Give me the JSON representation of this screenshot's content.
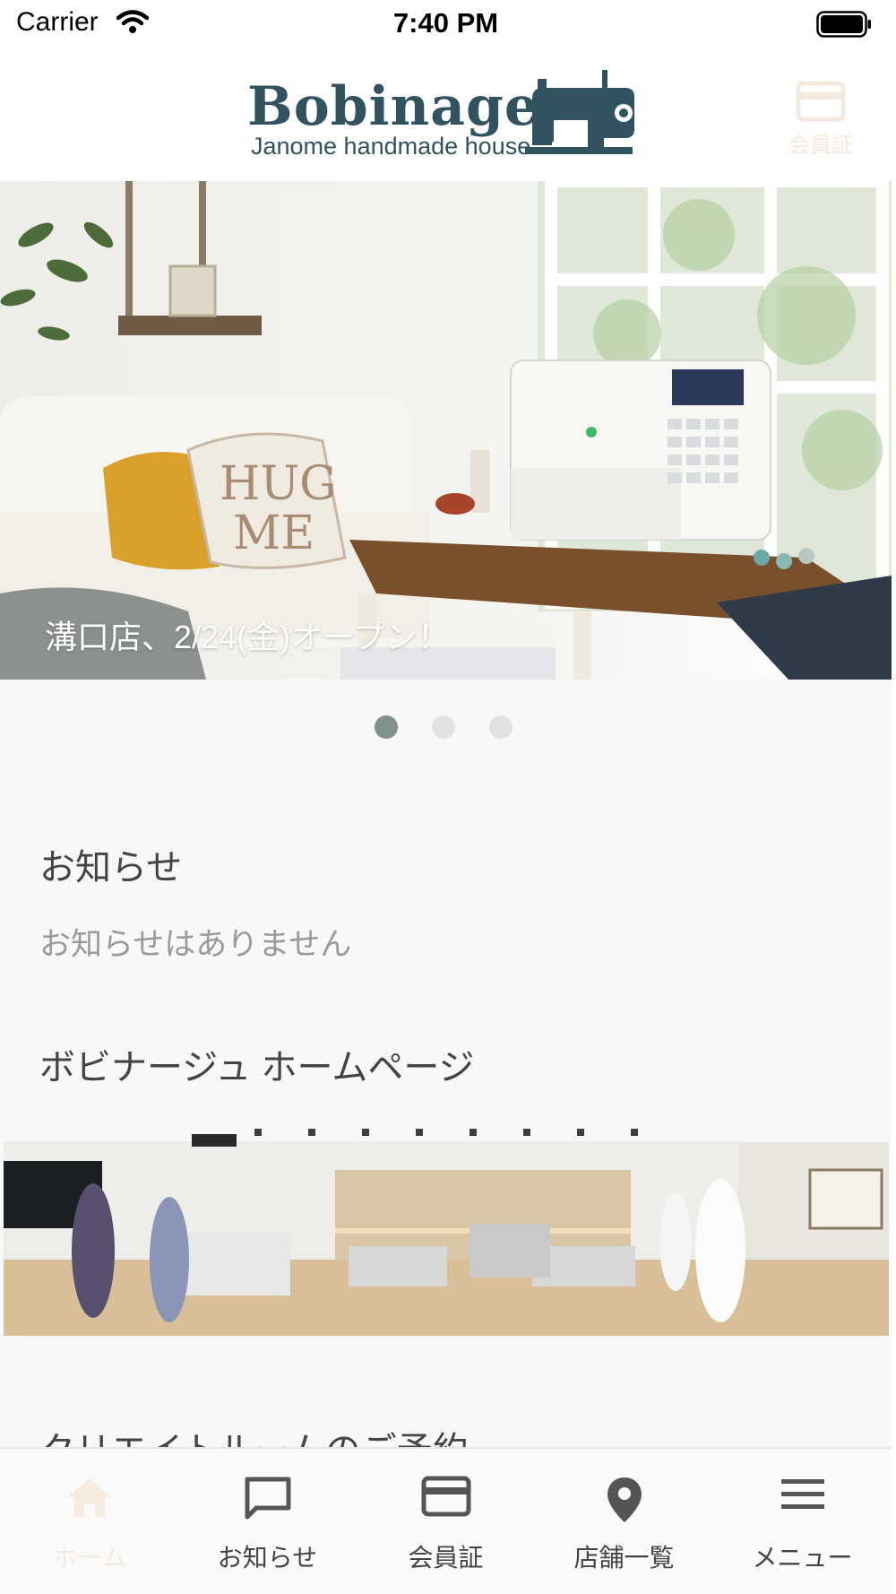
{
  "status_bar": {
    "carrier": "Carrier",
    "time": "7:40 PM"
  },
  "header": {
    "logo_title": "Bobinage",
    "logo_subtitle": "Janome handmade house",
    "member_card_label": "会員証"
  },
  "carousel": {
    "caption": "溝口店、2/24(金)オープン！",
    "slide_count": 3,
    "active_index": 0
  },
  "news": {
    "title": "お知らせ",
    "empty_message": "お知らせはありません"
  },
  "homepage": {
    "title": "ボビナージュ ホームページ"
  },
  "create_room": {
    "title": "クリエイトルームのご予約"
  },
  "tab_bar": {
    "items": [
      {
        "label": "ホーム",
        "icon": "home-icon",
        "active": true
      },
      {
        "label": "お知らせ",
        "icon": "chat-icon",
        "active": false
      },
      {
        "label": "会員証",
        "icon": "card-icon",
        "active": false
      },
      {
        "label": "店舗一覧",
        "icon": "location-pin-icon",
        "active": false
      },
      {
        "label": "メニュー",
        "icon": "menu-icon",
        "active": false
      }
    ]
  },
  "colors": {
    "brand": "#31525f",
    "tab_active": "#f5ebde",
    "dot_active": "#7f918a",
    "dot_inactive": "#e2e2e2"
  }
}
